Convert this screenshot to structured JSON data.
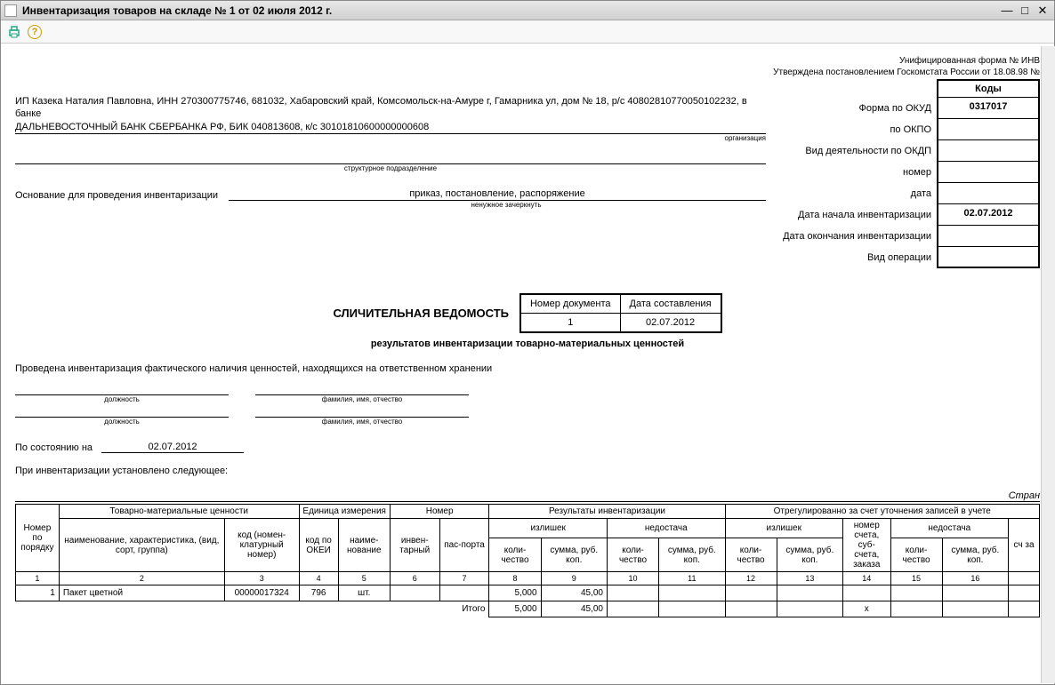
{
  "window": {
    "title": "Инвентаризация товаров на складе № 1 от 02 июля 2012 г."
  },
  "header": {
    "form_line": "Унифицированная форма № ИНВ",
    "approved_line": "Утверждена постановлением Госкомстата России от 18.08.98 №"
  },
  "codes": {
    "header": "Коды",
    "okud_label": "Форма по ОКУД",
    "okud": "0317017",
    "okpo_label": "по ОКПО",
    "okpo": "",
    "okdp_label": "Вид деятельности по ОКДП",
    "okdp": "",
    "number_label": "номер",
    "number": "",
    "date_label": "дата",
    "date": "",
    "start_label": "Дата начала инвентаризации",
    "start": "02.07.2012",
    "end_label": "Дата окончания инвентаризации",
    "end": "",
    "op_label": "Вид операции",
    "op": ""
  },
  "org": {
    "line1": "ИП Казека Наталия Павловна, ИНН 270300775746, 681032, Хабаровский край, Комсомольск-на-Амуре г, Гамарника ул, дом № 18, р/с 40802810770050102232, в банке",
    "line2": "ДАЛЬНЕВОСТОЧНЫЙ БАНК СБЕРБАНКА РФ, БИК 040813608, к/с 30101810600000000608",
    "org_hint": "организация",
    "struct_hint": "структурное подразделение"
  },
  "basis": {
    "label": "Основание для проведения инвентаризации",
    "value": "приказ, постановление, распоряжение",
    "hint": "ненужное зачеркнуть"
  },
  "doc": {
    "col1": "Номер документа",
    "col2": "Дата составления",
    "number": "1",
    "date": "02.07.2012",
    "title": "СЛИЧИТЕЛЬНАЯ ВЕДОМОСТЬ",
    "subtitle": "результатов инвентаризации товарно-материальных ценностей"
  },
  "body": {
    "conducted": "Проведена инвентаризация фактического наличия ценностей, находящихся на ответственном хранении",
    "position_hint": "должность",
    "fio_hint": "фамилия, имя, отчество",
    "asof_label": "По состоянию на",
    "asof_value": "02.07.2012",
    "established": "При инвентаризации установлено следующее:",
    "page_label": "Стран"
  },
  "table": {
    "h_num": "Номер по порядку",
    "h_goods": "Товарно-материальные ценности",
    "h_unit": "Единица измерения",
    "h_number": "Номер",
    "h_results": "Результаты инвентаризации",
    "h_adjusted": "Отрегулированно за счет уточнения записей в учете",
    "h_name": "наименование, характеристика, (вид, сорт, группа)",
    "h_code": "код (номен-клатурный номер)",
    "h_okei": "код по ОКЕИ",
    "h_unitname": "наиме-нование",
    "h_inv": "инвен-тарный",
    "h_pass": "пас-порта",
    "h_surplus": "излишек",
    "h_shortage": "недостача",
    "h_qty": "коли-чество",
    "h_sum": "сумма, руб. коп.",
    "h_acct": "номер счета, суб-счета, заказа",
    "h_ext": "сч за",
    "nums": [
      "1",
      "2",
      "3",
      "4",
      "5",
      "6",
      "7",
      "8",
      "9",
      "10",
      "11",
      "12",
      "13",
      "14",
      "15",
      "16",
      ""
    ],
    "row1": {
      "n": "1",
      "name": "Пакет цветной",
      "code": "00000017324",
      "okei": "796",
      "unit": "шт.",
      "inv": "",
      "pass": "",
      "sq": "5,000",
      "ss": "45,00",
      "dq": "",
      "ds": "",
      "aq": "",
      "as": "",
      "acct": "",
      "bq": "",
      "bs": ""
    },
    "total_label": "Итого",
    "total": {
      "sq": "5,000",
      "ss": "45,00",
      "aq": "",
      "acct": "х"
    }
  }
}
